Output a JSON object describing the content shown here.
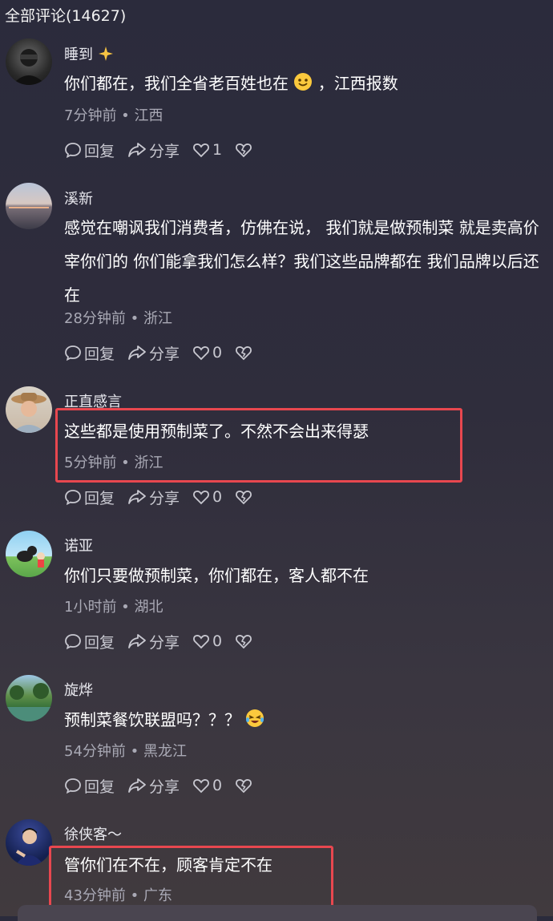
{
  "header": {
    "title": "全部评论(14627)"
  },
  "actions": {
    "reply": "回复",
    "share": "分享"
  },
  "comments": [
    {
      "username": "睡到",
      "text_a": "你们都在，我们全省老百姓也在",
      "text_b": "，江西报数",
      "time": "7分钟前",
      "location": "江西",
      "likes": "1"
    },
    {
      "username": "溪新",
      "text": "感觉在嘲讽我们消费者，仿佛在说， 我们就是做预制菜 就是卖高价宰你们的 你们能拿我们怎么样？我们这些品牌都在 我们品牌以后还在",
      "time": "28分钟前",
      "location": "浙江",
      "likes": "0"
    },
    {
      "username": "正直感言",
      "text": "这些都是使用预制菜了。不然不会出来得瑟",
      "time": "5分钟前",
      "location": "浙江",
      "likes": "0"
    },
    {
      "username": "诺亚",
      "text": "你们只要做预制菜，你们都在，客人都不在",
      "time": "1小时前",
      "location": "湖北",
      "likes": "0"
    },
    {
      "username": "旋烨",
      "text": "预制菜餐饮联盟吗？？？",
      "time": "54分钟前",
      "location": "黑龙江",
      "likes": "0"
    },
    {
      "username": "徐侠客～",
      "text": "管你们在不在，顾客肯定不在",
      "time": "43分钟前",
      "location": "广东"
    }
  ],
  "meta_separator": " • ",
  "colors": {
    "highlight": "#e8474f",
    "background": "#2f2d3c"
  },
  "icons": [
    "comment-bubble-icon",
    "share-arrow-icon",
    "heart-icon",
    "broken-heart-icon",
    "sparkle-icon",
    "smile-emoji-icon",
    "laughing-crying-emoji-icon"
  ]
}
